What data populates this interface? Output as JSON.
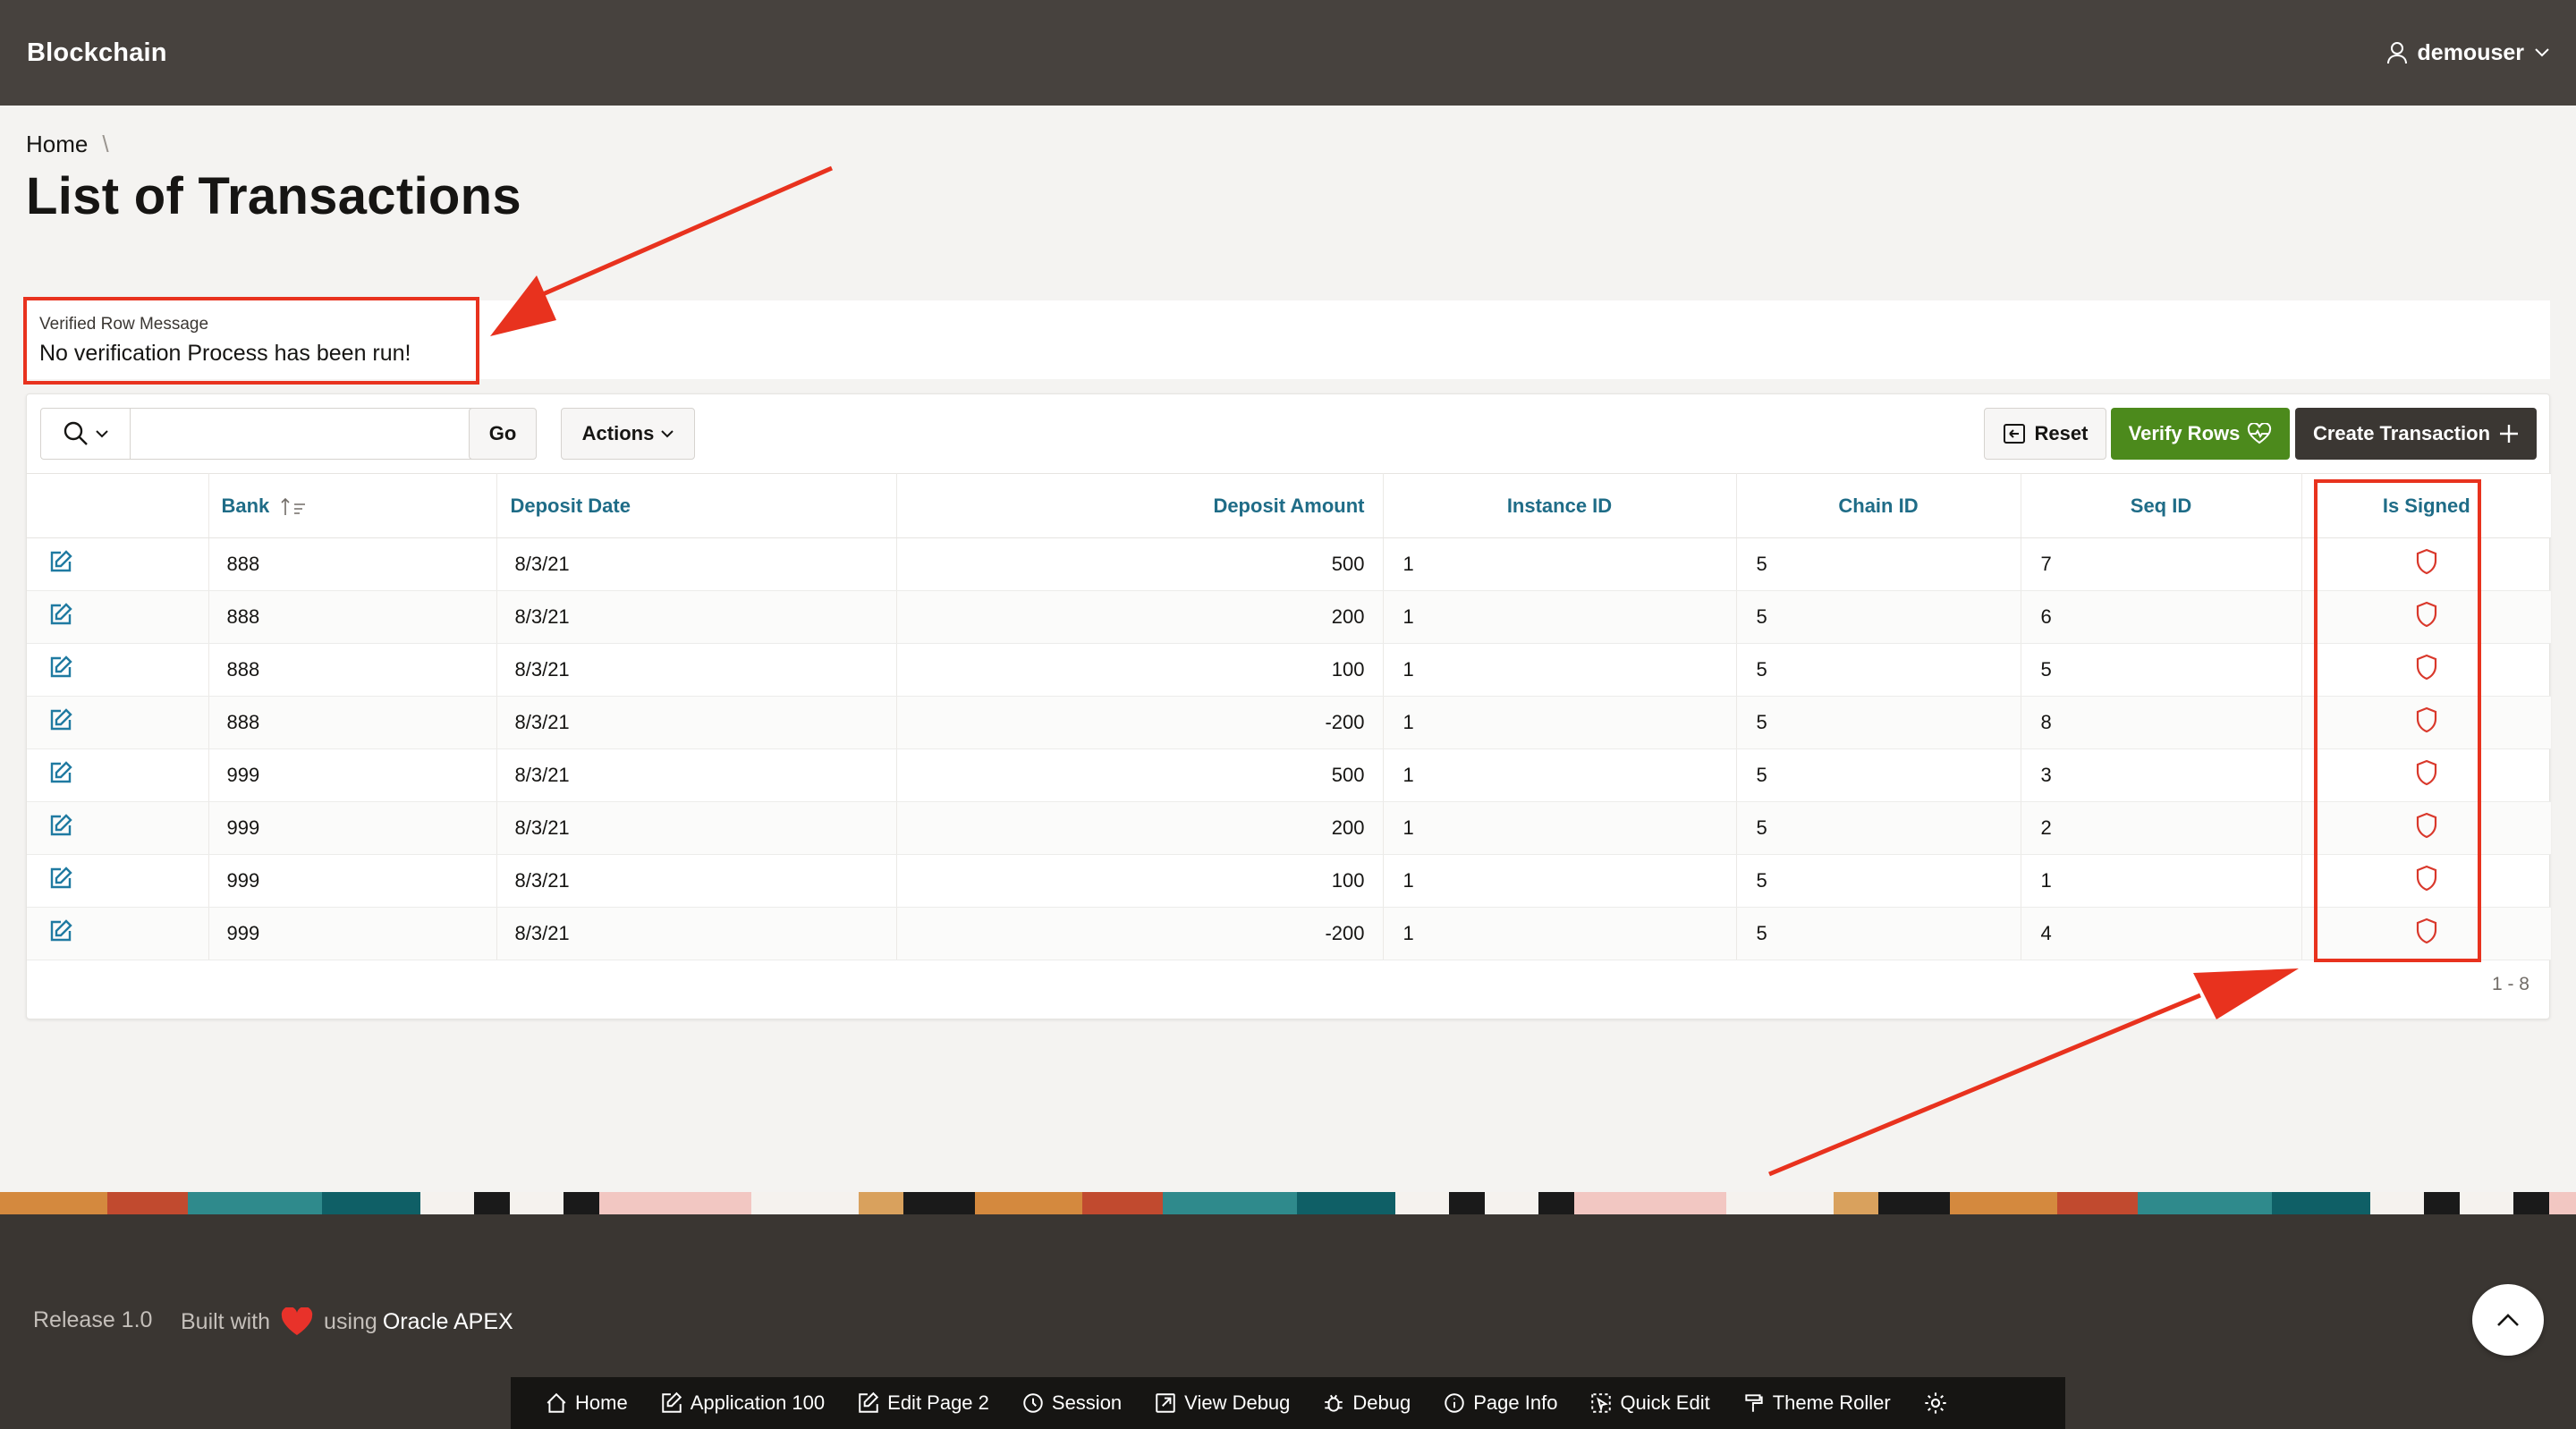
{
  "header": {
    "app_title": "Blockchain",
    "user": "demouser"
  },
  "breadcrumb": {
    "home": "Home",
    "separator": "\\"
  },
  "page_title": "List of Transactions",
  "message": {
    "label": "Verified Row Message",
    "value": "No verification Process has been run!"
  },
  "toolbar": {
    "go": "Go",
    "actions": "Actions",
    "reset": "Reset",
    "verify": "Verify Rows",
    "create": "Create Transaction",
    "search_placeholder": ""
  },
  "columns": {
    "bank": "Bank",
    "deposit_date": "Deposit Date",
    "deposit_amount": "Deposit Amount",
    "instance_id": "Instance ID",
    "chain_id": "Chain ID",
    "seq_id": "Seq ID",
    "is_signed": "Is Signed"
  },
  "rows": [
    {
      "bank": "888",
      "date": "8/3/21",
      "amount": "500",
      "instance": "1",
      "chain": "5",
      "seq": "7"
    },
    {
      "bank": "888",
      "date": "8/3/21",
      "amount": "200",
      "instance": "1",
      "chain": "5",
      "seq": "6"
    },
    {
      "bank": "888",
      "date": "8/3/21",
      "amount": "100",
      "instance": "1",
      "chain": "5",
      "seq": "5"
    },
    {
      "bank": "888",
      "date": "8/3/21",
      "amount": "-200",
      "instance": "1",
      "chain": "5",
      "seq": "8"
    },
    {
      "bank": "999",
      "date": "8/3/21",
      "amount": "500",
      "instance": "1",
      "chain": "5",
      "seq": "3"
    },
    {
      "bank": "999",
      "date": "8/3/21",
      "amount": "200",
      "instance": "1",
      "chain": "5",
      "seq": "2"
    },
    {
      "bank": "999",
      "date": "8/3/21",
      "amount": "100",
      "instance": "1",
      "chain": "5",
      "seq": "1"
    },
    {
      "bank": "999",
      "date": "8/3/21",
      "amount": "-200",
      "instance": "1",
      "chain": "5",
      "seq": "4"
    }
  ],
  "pagination": "1 - 8",
  "footer": {
    "release": "Release 1.0",
    "built_with": "Built with",
    "using": "using",
    "oracle_apex": "Oracle APEX"
  },
  "dev_toolbar": [
    {
      "label": "Home",
      "icon": "home-icon"
    },
    {
      "label": "Application 100",
      "icon": "edit-icon"
    },
    {
      "label": "Edit Page 2",
      "icon": "edit-icon"
    },
    {
      "label": "Session",
      "icon": "session-icon"
    },
    {
      "label": "View Debug",
      "icon": "external-icon"
    },
    {
      "label": "Debug",
      "icon": "bug-icon"
    },
    {
      "label": "Page Info",
      "icon": "info-icon"
    },
    {
      "label": "Quick Edit",
      "icon": "cursor-icon"
    },
    {
      "label": "Theme Roller",
      "icon": "brush-icon"
    }
  ],
  "colors": {
    "header_bg": "#47423e",
    "link": "#1f6c87",
    "verify_btn": "#4c8a1c",
    "create_btn": "#3b3733",
    "annotation": "#e8321e",
    "signed_icon": "#d9382b"
  }
}
